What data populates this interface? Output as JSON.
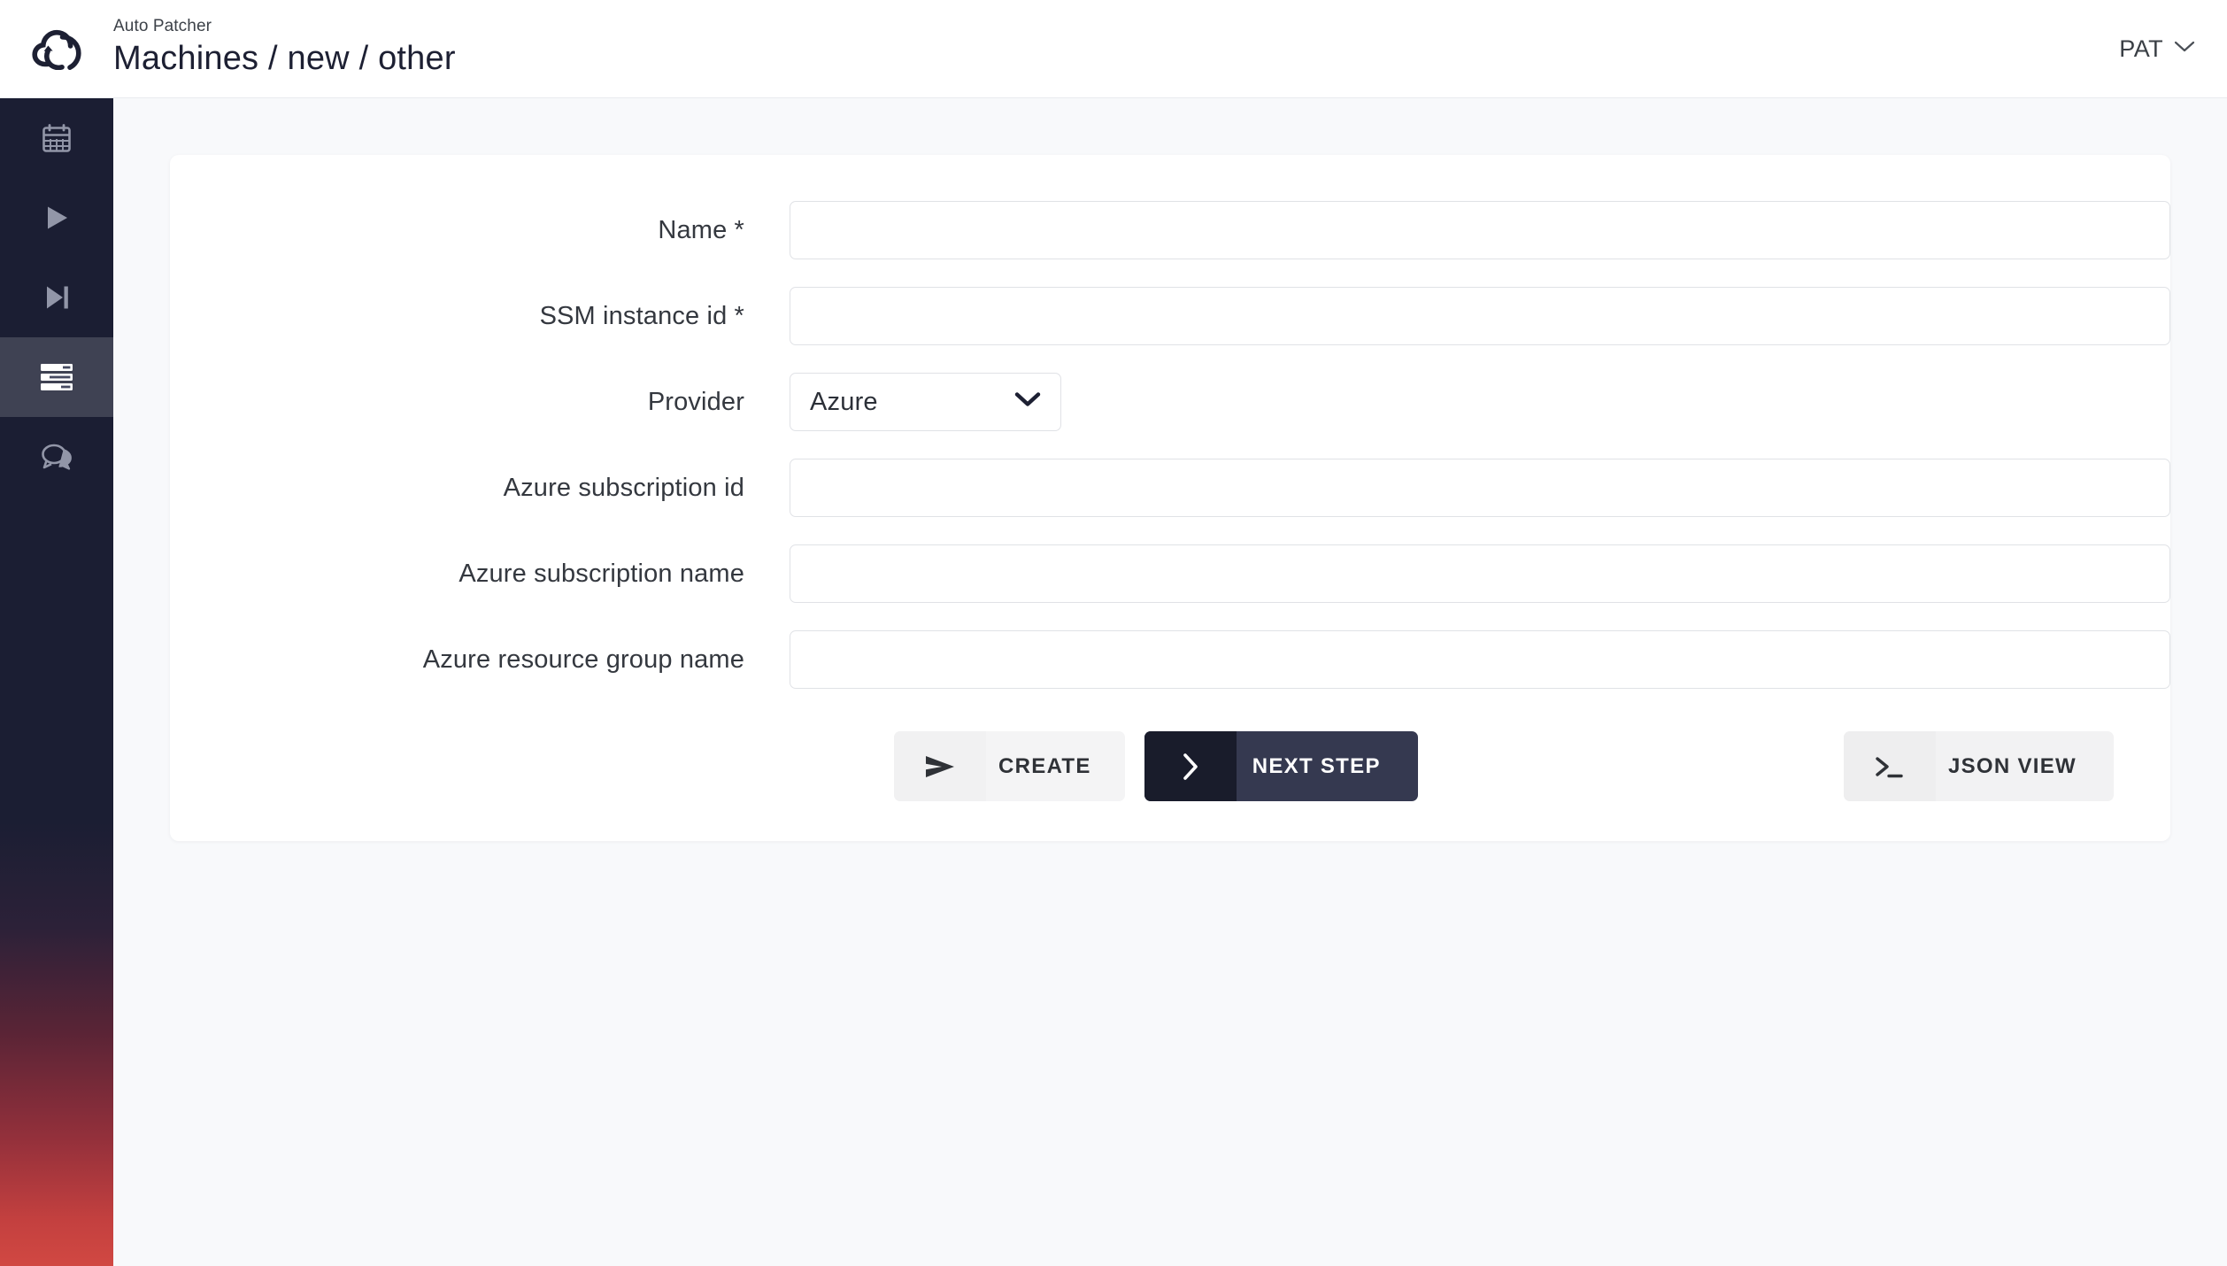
{
  "header": {
    "app_name": "Auto Patcher",
    "breadcrumb_title": "Machines / new / other",
    "logo_icon": "cloud-refresh-logo",
    "user_menu_label": "PAT",
    "user_menu_icon": "chevron-down-icon"
  },
  "sidebar": {
    "items": [
      {
        "icon": "calendar-icon",
        "name": "schedules",
        "active": false
      },
      {
        "icon": "play-icon",
        "name": "runs",
        "active": false
      },
      {
        "icon": "skip-forward-icon",
        "name": "steps",
        "active": false
      },
      {
        "icon": "server-rack-icon",
        "name": "machines",
        "active": true
      },
      {
        "icon": "chat-bubbles-icon",
        "name": "messages",
        "active": false
      }
    ],
    "gradient_top": "#1b1e33",
    "gradient_bottom": "#d14842",
    "active_item_bg": "#464a61"
  },
  "form": {
    "fields": [
      {
        "label": "Name *",
        "name": "name",
        "type": "text",
        "value": "",
        "placeholder": ""
      },
      {
        "label": "SSM instance id *",
        "name": "ssm-instance-id",
        "type": "text",
        "value": "",
        "placeholder": ""
      },
      {
        "label": "Provider",
        "name": "provider",
        "type": "select",
        "value": "Azure",
        "options": [
          "Azure"
        ]
      },
      {
        "label": "Azure subscription id",
        "name": "azure-subscription-id",
        "type": "text",
        "value": "",
        "placeholder": ""
      },
      {
        "label": "Azure subscription name",
        "name": "azure-subscription-name",
        "type": "text",
        "value": "",
        "placeholder": ""
      },
      {
        "label": "Azure resource group name",
        "name": "azure-resource-group-name",
        "type": "text",
        "value": "",
        "placeholder": ""
      }
    ]
  },
  "actions": {
    "create": {
      "label": "CREATE",
      "icon": "send-icon"
    },
    "next_step": {
      "label": "NEXT STEP",
      "icon": "chevron-right-icon"
    },
    "json_view": {
      "label": "JSON VIEW",
      "icon": "terminal-icon"
    }
  },
  "colors": {
    "page_bg": "#f8f9fb",
    "card_bg": "#ffffff",
    "primary_dark": "#353950",
    "primary_darker": "#191c2b",
    "text": "#34383f",
    "border": "#e0e2e6"
  }
}
